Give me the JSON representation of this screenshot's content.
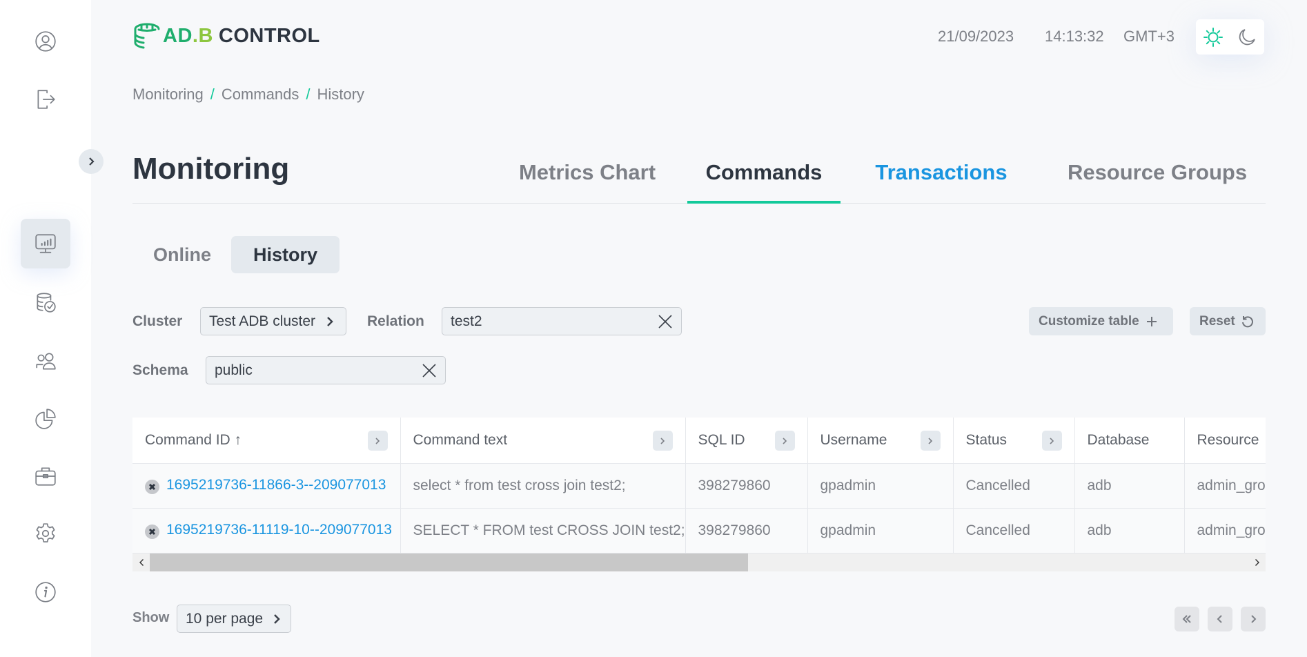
{
  "app": {
    "logo_primary": "AD.B",
    "logo_secondary": "CONTROL",
    "brand_color": "#1fae6d",
    "accent_color": "#13c99a",
    "link_color": "#1a95e0"
  },
  "header": {
    "date": "21/09/2023",
    "time": "14:13:32",
    "timezone": "GMT+3",
    "theme_options": [
      "light-theme-icon",
      "dark-theme-icon"
    ],
    "theme_selected": "light"
  },
  "sidebar": {
    "top_items": [
      {
        "icon": "user-profile-icon"
      },
      {
        "icon": "logout-icon"
      }
    ],
    "nav_items": [
      {
        "icon": "monitoring-icon",
        "active": true
      },
      {
        "icon": "database-backup-icon",
        "active": false
      },
      {
        "icon": "users-icon",
        "active": false
      },
      {
        "icon": "pie-chart-icon",
        "active": false
      },
      {
        "icon": "briefcase-icon",
        "active": false
      },
      {
        "icon": "settings-icon",
        "active": false
      },
      {
        "icon": "info-icon",
        "active": false
      }
    ]
  },
  "breadcrumb": {
    "items": [
      "Monitoring",
      "Commands",
      "History"
    ],
    "separator": "/"
  },
  "page": {
    "title": "Monitoring",
    "tabs": [
      {
        "label": "Metrics Chart",
        "state": "inactive"
      },
      {
        "label": "Commands",
        "state": "active"
      },
      {
        "label": "Transactions",
        "state": "hover"
      },
      {
        "label": "Resource Groups",
        "state": "inactive"
      }
    ],
    "sub_tabs": [
      {
        "label": "Online",
        "active": false
      },
      {
        "label": "History",
        "active": true
      }
    ]
  },
  "filters": {
    "cluster_label": "Cluster",
    "cluster_value": "Test ADB cluster",
    "relation_label": "Relation",
    "relation_value": "test2",
    "schema_label": "Schema",
    "schema_value": "public",
    "customize_label": "Customize table",
    "reset_label": "Reset"
  },
  "table": {
    "columns": [
      {
        "label": "Command ID",
        "sort": "asc",
        "expandable": true
      },
      {
        "label": "Command text",
        "expandable": true
      },
      {
        "label": "SQL ID",
        "expandable": true
      },
      {
        "label": "Username",
        "expandable": true
      },
      {
        "label": "Status",
        "expandable": true
      },
      {
        "label": "Database",
        "expandable": false
      },
      {
        "label": "Resource",
        "expandable": false
      }
    ],
    "sort_indicator": "↑",
    "rows": [
      {
        "command_id": "1695219736-11866-3--209077013",
        "command_text": "select * from test cross join test2;",
        "sql_id": "398279860",
        "username": "gpadmin",
        "status": "Cancelled",
        "database": "adb",
        "resource": "admin_group"
      },
      {
        "command_id": "1695219736-11119-10--209077013",
        "command_text": "SELECT * FROM test CROSS JOIN test2;",
        "sql_id": "398279860",
        "username": "gpadmin",
        "status": "Cancelled",
        "database": "adb",
        "resource": "admin_group"
      }
    ],
    "horizontal_scroll_fraction": 0.0
  },
  "pagination": {
    "show_label": "Show",
    "per_page": "10 per page"
  }
}
